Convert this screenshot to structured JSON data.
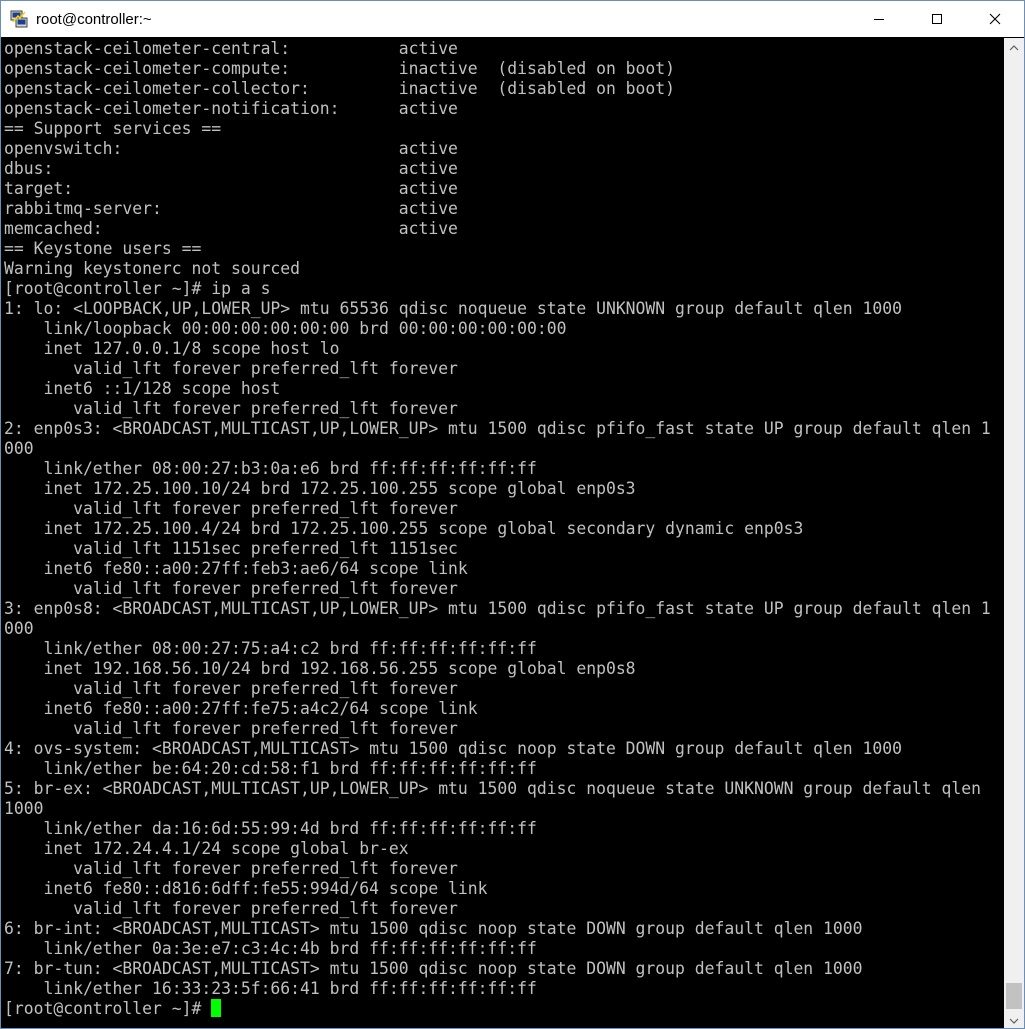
{
  "window": {
    "title": "root@controller:~",
    "icon": "putty-icon",
    "controls": [
      "minimize-icon",
      "maximize-icon",
      "close-icon"
    ]
  },
  "terminal": {
    "colors": {
      "background": "#000000",
      "foreground": "#c0c0c0",
      "cursor": "#00ff00"
    },
    "lines": [
      "openstack-ceilometer-central:           active",
      "openstack-ceilometer-compute:           inactive  (disabled on boot)",
      "openstack-ceilometer-collector:         inactive  (disabled on boot)",
      "openstack-ceilometer-notification:      active",
      "== Support services ==",
      "openvswitch:                            active",
      "dbus:                                   active",
      "target:                                 active",
      "rabbitmq-server:                        active",
      "memcached:                              active",
      "== Keystone users ==",
      "Warning keystonerc not sourced",
      "[root@controller ~]# ip a s",
      "1: lo: <LOOPBACK,UP,LOWER_UP> mtu 65536 qdisc noqueue state UNKNOWN group default qlen 1000",
      "    link/loopback 00:00:00:00:00:00 brd 00:00:00:00:00:00",
      "    inet 127.0.0.1/8 scope host lo",
      "       valid_lft forever preferred_lft forever",
      "    inet6 ::1/128 scope host",
      "       valid_lft forever preferred_lft forever",
      "2: enp0s3: <BROADCAST,MULTICAST,UP,LOWER_UP> mtu 1500 qdisc pfifo_fast state UP group default qlen 1",
      "000",
      "    link/ether 08:00:27:b3:0a:e6 brd ff:ff:ff:ff:ff:ff",
      "    inet 172.25.100.10/24 brd 172.25.100.255 scope global enp0s3",
      "       valid_lft forever preferred_lft forever",
      "    inet 172.25.100.4/24 brd 172.25.100.255 scope global secondary dynamic enp0s3",
      "       valid_lft 1151sec preferred_lft 1151sec",
      "    inet6 fe80::a00:27ff:feb3:ae6/64 scope link",
      "       valid_lft forever preferred_lft forever",
      "3: enp0s8: <BROADCAST,MULTICAST,UP,LOWER_UP> mtu 1500 qdisc pfifo_fast state UP group default qlen 1",
      "000",
      "    link/ether 08:00:27:75:a4:c2 brd ff:ff:ff:ff:ff:ff",
      "    inet 192.168.56.10/24 brd 192.168.56.255 scope global enp0s8",
      "       valid_lft forever preferred_lft forever",
      "    inet6 fe80::a00:27ff:fe75:a4c2/64 scope link",
      "       valid_lft forever preferred_lft forever",
      "4: ovs-system: <BROADCAST,MULTICAST> mtu 1500 qdisc noop state DOWN group default qlen 1000",
      "    link/ether be:64:20:cd:58:f1 brd ff:ff:ff:ff:ff:ff",
      "5: br-ex: <BROADCAST,MULTICAST,UP,LOWER_UP> mtu 1500 qdisc noqueue state UNKNOWN group default qlen",
      "1000",
      "    link/ether da:16:6d:55:99:4d brd ff:ff:ff:ff:ff:ff",
      "    inet 172.24.4.1/24 scope global br-ex",
      "       valid_lft forever preferred_lft forever",
      "    inet6 fe80::d816:6dff:fe55:994d/64 scope link",
      "       valid_lft forever preferred_lft forever",
      "6: br-int: <BROADCAST,MULTICAST> mtu 1500 qdisc noop state DOWN group default qlen 1000",
      "    link/ether 0a:3e:e7:c3:4c:4b brd ff:ff:ff:ff:ff:ff",
      "7: br-tun: <BROADCAST,MULTICAST> mtu 1500 qdisc noop state DOWN group default qlen 1000",
      "    link/ether 16:33:23:5f:66:41 brd ff:ff:ff:ff:ff:ff"
    ],
    "prompt": "[root@controller ~]# "
  }
}
